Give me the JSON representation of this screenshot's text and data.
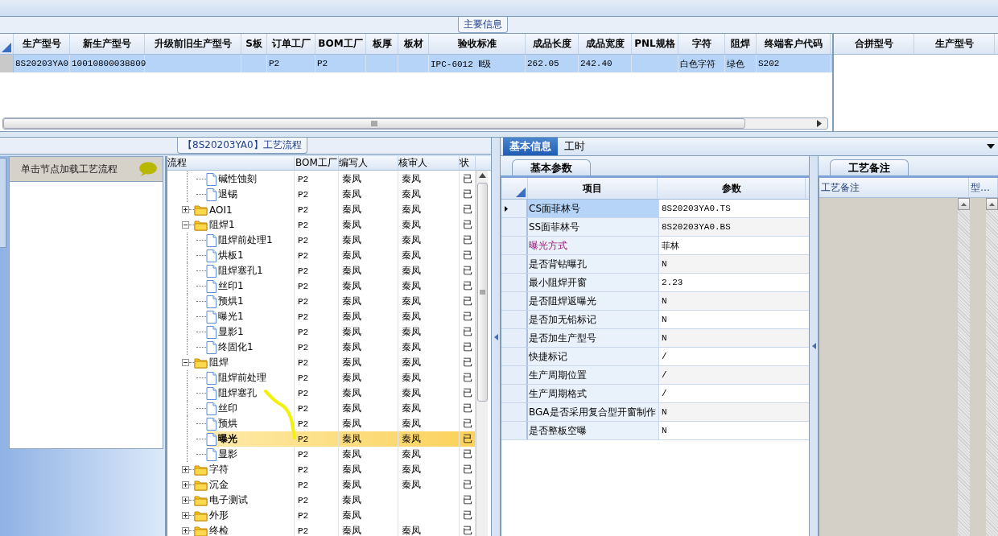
{
  "main_info": {
    "title": "主要信息",
    "columns": [
      "生产型号",
      "新生产型号",
      "升级前旧生产型号",
      "S板",
      "订单工厂",
      "BOM工厂",
      "板厚",
      "板材",
      "验收标准",
      "成品长度",
      "成品宽度",
      "PNL规格",
      "字符",
      "阻焊",
      "终端客户代码"
    ],
    "rows": [
      {
        "selected": true,
        "cells": [
          "8S20203YA0",
          "10010800038809",
          null,
          null,
          "P2",
          "P2",
          null,
          null,
          "IPC-6012 Ⅱ级",
          "262.05",
          "242.40",
          null,
          "白色字符",
          "绿色",
          "S202"
        ]
      }
    ]
  },
  "merge_grid": {
    "columns": [
      "合拼型号",
      "生产型号"
    ]
  },
  "process_flow": {
    "title": "【8S20203YA0】工艺流程",
    "hint": "单击节点加载工艺流程",
    "columns": [
      "流程",
      "BOM工厂",
      "编写人",
      "核审人",
      "状"
    ],
    "tree": [
      {
        "kind": "offscreen",
        "children": [
          {
            "kind": "file",
            "name": "碱性蚀刻",
            "bom": "P2",
            "writer": "秦凤",
            "reviewer": "秦凤",
            "status": "已",
            "selected": false
          },
          {
            "kind": "file",
            "name": "退锡",
            "bom": "P2",
            "writer": "秦凤",
            "reviewer": "秦凤",
            "status": "已",
            "selected": false
          }
        ]
      },
      {
        "kind": "folder",
        "name": "AOI1",
        "expanded": false,
        "bom": "P2",
        "writer": "秦凤",
        "reviewer": "秦凤",
        "status": "已",
        "selected": false
      },
      {
        "kind": "folder",
        "name": "阻焊1",
        "expanded": true,
        "bom": "P2",
        "writer": "秦凤",
        "reviewer": "秦凤",
        "status": "已",
        "selected": false,
        "children": [
          {
            "kind": "file",
            "name": "阻焊前处理1",
            "bom": "P2",
            "writer": "秦凤",
            "reviewer": "秦凤",
            "status": "已",
            "selected": false
          },
          {
            "kind": "file",
            "name": "烘板1",
            "bom": "P2",
            "writer": "秦凤",
            "reviewer": "秦凤",
            "status": "已",
            "selected": false
          },
          {
            "kind": "file",
            "name": "阻焊塞孔1",
            "bom": "P2",
            "writer": "秦凤",
            "reviewer": "秦凤",
            "status": "已",
            "selected": false
          },
          {
            "kind": "file",
            "name": "丝印1",
            "bom": "P2",
            "writer": "秦凤",
            "reviewer": "秦凤",
            "status": "已",
            "selected": false
          },
          {
            "kind": "file",
            "name": "预烘1",
            "bom": "P2",
            "writer": "秦凤",
            "reviewer": "秦凤",
            "status": "已",
            "selected": false
          },
          {
            "kind": "file",
            "name": "曝光1",
            "bom": "P2",
            "writer": "秦凤",
            "reviewer": "秦凤",
            "status": "已",
            "selected": false
          },
          {
            "kind": "file",
            "name": "显影1",
            "bom": "P2",
            "writer": "秦凤",
            "reviewer": "秦凤",
            "status": "已",
            "selected": false
          },
          {
            "kind": "file",
            "name": "终固化1",
            "bom": "P2",
            "writer": "秦凤",
            "reviewer": "秦凤",
            "status": "已",
            "selected": false
          }
        ]
      },
      {
        "kind": "folder",
        "name": "阻焊",
        "expanded": true,
        "bom": "P2",
        "writer": "秦凤",
        "reviewer": "秦凤",
        "status": "已",
        "selected": false,
        "children": [
          {
            "kind": "file",
            "name": "阻焊前处理",
            "bom": "P2",
            "writer": "秦凤",
            "reviewer": "秦凤",
            "status": "已",
            "selected": false
          },
          {
            "kind": "file",
            "name": "阻焊塞孔",
            "bom": "P2",
            "writer": "秦凤",
            "reviewer": "秦凤",
            "status": "已",
            "selected": false
          },
          {
            "kind": "file",
            "name": "丝印",
            "bom": "P2",
            "writer": "秦凤",
            "reviewer": "秦凤",
            "status": "已",
            "selected": false
          },
          {
            "kind": "file",
            "name": "预烘",
            "bom": "P2",
            "writer": "秦凤",
            "reviewer": "秦凤",
            "status": "已",
            "selected": false
          },
          {
            "kind": "file",
            "name": "曝光",
            "bom": "P2",
            "writer": "秦凤",
            "reviewer": "秦凤",
            "status": "已",
            "selected": true
          },
          {
            "kind": "file",
            "name": "显影",
            "bom": "P2",
            "writer": "秦凤",
            "reviewer": "秦凤",
            "status": "已",
            "selected": false
          }
        ]
      },
      {
        "kind": "folder",
        "name": "字符",
        "expanded": false,
        "bom": "P2",
        "writer": "秦凤",
        "reviewer": "秦凤",
        "status": "已",
        "selected": false
      },
      {
        "kind": "folder",
        "name": "沉金",
        "expanded": false,
        "bom": "P2",
        "writer": "秦凤",
        "reviewer": "秦凤",
        "status": "已",
        "selected": false
      },
      {
        "kind": "folder",
        "name": "电子测试",
        "expanded": false,
        "bom": "P2",
        "writer": "秦凤",
        "status": "已",
        "selected": false
      },
      {
        "kind": "folder",
        "name": "外形",
        "expanded": false,
        "bom": "P2",
        "writer": "秦凤",
        "status": "已",
        "selected": false
      },
      {
        "kind": "folder",
        "name": "终检",
        "expanded": false,
        "bom": "P2",
        "writer": "秦凤",
        "reviewer": "秦凤",
        "status": "已",
        "selected": false
      }
    ]
  },
  "detail_tabs": [
    {
      "label": "基本信息",
      "selected": true
    },
    {
      "label": "工时",
      "selected": false
    }
  ],
  "basic_params": {
    "tab": "基本参数",
    "columns": [
      "项目",
      "参数"
    ],
    "rows": [
      {
        "name": "CS面菲林号",
        "value": "8S20203YA0.TS",
        "selected": true,
        "highlight": false
      },
      {
        "name": "SS面菲林号",
        "value": "8S20203YA0.BS",
        "selected": false,
        "highlight": false
      },
      {
        "name": "曝光方式",
        "value": "菲林",
        "selected": false,
        "highlight": true
      },
      {
        "name": "是否背钻曝孔",
        "value": "N",
        "selected": false,
        "highlight": false
      },
      {
        "name": "最小阻焊开窗",
        "value": "2.23",
        "selected": false,
        "highlight": false
      },
      {
        "name": "是否阻焊返曝光",
        "value": "N",
        "selected": false,
        "highlight": false
      },
      {
        "name": "是否加无铅标记",
        "value": "N",
        "selected": false,
        "highlight": false
      },
      {
        "name": "是否加生产型号",
        "value": "N",
        "selected": false,
        "highlight": false
      },
      {
        "name": "快捷标记",
        "value": "/",
        "selected": false,
        "highlight": false
      },
      {
        "name": "生产周期位置",
        "value": "/",
        "selected": false,
        "highlight": false
      },
      {
        "name": "生产周期格式",
        "value": "/",
        "selected": false,
        "highlight": false
      },
      {
        "name": "BGA是否采用复合型开窗制作",
        "value": "N",
        "selected": false,
        "highlight": false
      },
      {
        "name": "是否整板空曝",
        "value": "N",
        "selected": false,
        "highlight": false
      }
    ]
  },
  "process_notes": {
    "tab": "工艺备注",
    "columns": [
      "工艺备注",
      "型…"
    ]
  }
}
